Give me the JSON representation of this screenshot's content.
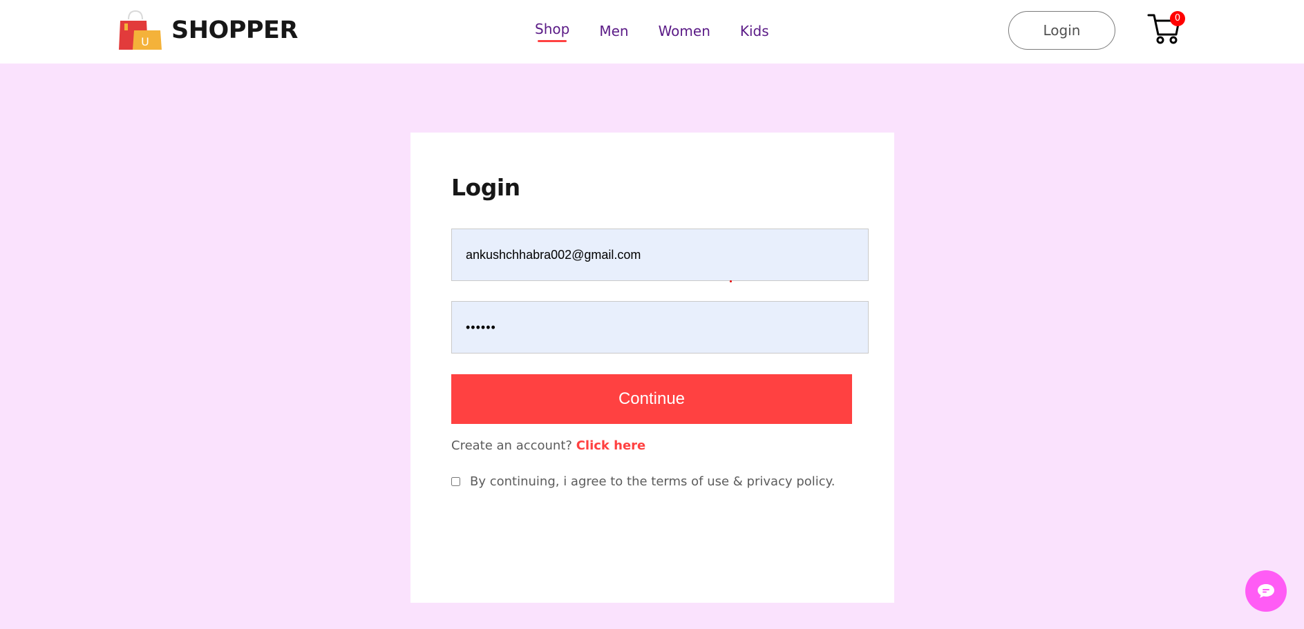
{
  "brand": {
    "name": "SHOPPER",
    "logo_letter": "U"
  },
  "nav": {
    "items": [
      {
        "label": "Shop",
        "active": true
      },
      {
        "label": "Men",
        "active": false
      },
      {
        "label": "Women",
        "active": false
      },
      {
        "label": "Kids",
        "active": false
      }
    ]
  },
  "header": {
    "login_label": "Login",
    "cart_count": "0"
  },
  "login_form": {
    "title": "Login",
    "email_value": "ankushchhabra002@gmail.com",
    "password_value": "••••••",
    "continue_label": "Continue",
    "signup_prompt": "Create an account?",
    "signup_link": "Click here",
    "agree_text": "By continuing, i agree to the terms of use & privacy policy."
  },
  "colors": {
    "page_background": "#fae2fd",
    "accent": "#ff4141",
    "nav_text": "#5a1a86",
    "chat_button": "#ff5cf5"
  },
  "icons": {
    "logo": "shopping-bag-icon",
    "cart": "cart-icon",
    "chat": "chat-bubble-icon"
  }
}
